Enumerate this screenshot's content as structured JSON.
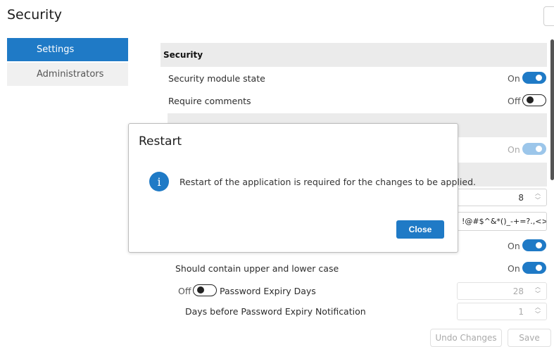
{
  "page": {
    "title": "Security"
  },
  "sidebar": {
    "items": [
      {
        "label": "Settings",
        "active": true
      },
      {
        "label": "Administrators",
        "active": false
      }
    ]
  },
  "security": {
    "header": "Security",
    "module_state": {
      "label": "Security module state",
      "state": "On"
    },
    "require_comments": {
      "label": "Require comments",
      "state": "Off"
    },
    "audit_state": {
      "state": "On"
    },
    "min_length": {
      "value": "8"
    },
    "special_chars": {
      "value": "!@#$^&*()_-+=?.,<>|"
    },
    "special_toggle": {
      "state": "On"
    },
    "upper_lower": {
      "label": "Should contain upper and lower case",
      "state": "On"
    },
    "expiry": {
      "toggle_state": "Off",
      "label": "Password Expiry Days",
      "value": "28"
    },
    "expiry_notify": {
      "label": "Days before Password Expiry Notification",
      "value": "1"
    }
  },
  "footer": {
    "undo_label": "Undo Changes",
    "save_label": "Save"
  },
  "dialog": {
    "title": "Restart",
    "message": "Restart of the application is required for the changes to be applied.",
    "close_label": "Close",
    "icon": "info-icon"
  },
  "colors": {
    "accent": "#1f7ac6",
    "header_bg": "#ebebeb"
  }
}
